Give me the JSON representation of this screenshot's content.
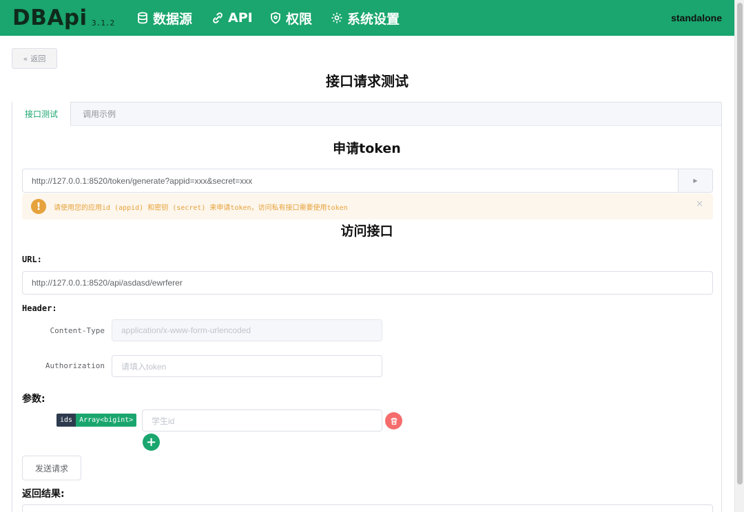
{
  "header": {
    "logo": "DBApi",
    "version": "3.1.2",
    "nav": [
      {
        "label": "数据源",
        "icon": "database-icon"
      },
      {
        "label": "API",
        "icon": "api-icon"
      },
      {
        "label": "权限",
        "icon": "shield-icon"
      },
      {
        "label": "系统设置",
        "icon": "gear-icon"
      }
    ],
    "user": "standalone"
  },
  "page": {
    "back_label": "返回",
    "title": "接口请求测试"
  },
  "tabs": [
    {
      "label": "接口测试",
      "active": true
    },
    {
      "label": "调用示例",
      "active": false
    }
  ],
  "token_section": {
    "title": "申请token",
    "url": "http://127.0.0.1:8520/token/generate?appid=xxx&secret=xxx",
    "alert": "请使用您的应用id (appid) 和密钥 (secret) 来申请token，访问私有接口需要使用token",
    "alert_close": "×"
  },
  "access_section": {
    "title": "访问接口",
    "url_label": "URL:",
    "url_value": "http://127.0.0.1:8520/api/asdasd/ewrferer",
    "header_label": "Header:",
    "headers": [
      {
        "key": "Content-Type",
        "value": "application/x-www-form-urlencoded"
      },
      {
        "key": "Authorization",
        "placeholder": "请填入token"
      }
    ],
    "params_label": "参数:",
    "params": [
      {
        "name": "ids",
        "type": "Array<bigint>",
        "placeholder": "学生id"
      }
    ],
    "send_label": "发送请求",
    "result_label": "返回结果:"
  },
  "colors": {
    "brand": "#1aa66e",
    "warning": "#e6a23c",
    "danger": "#f56c6c"
  }
}
